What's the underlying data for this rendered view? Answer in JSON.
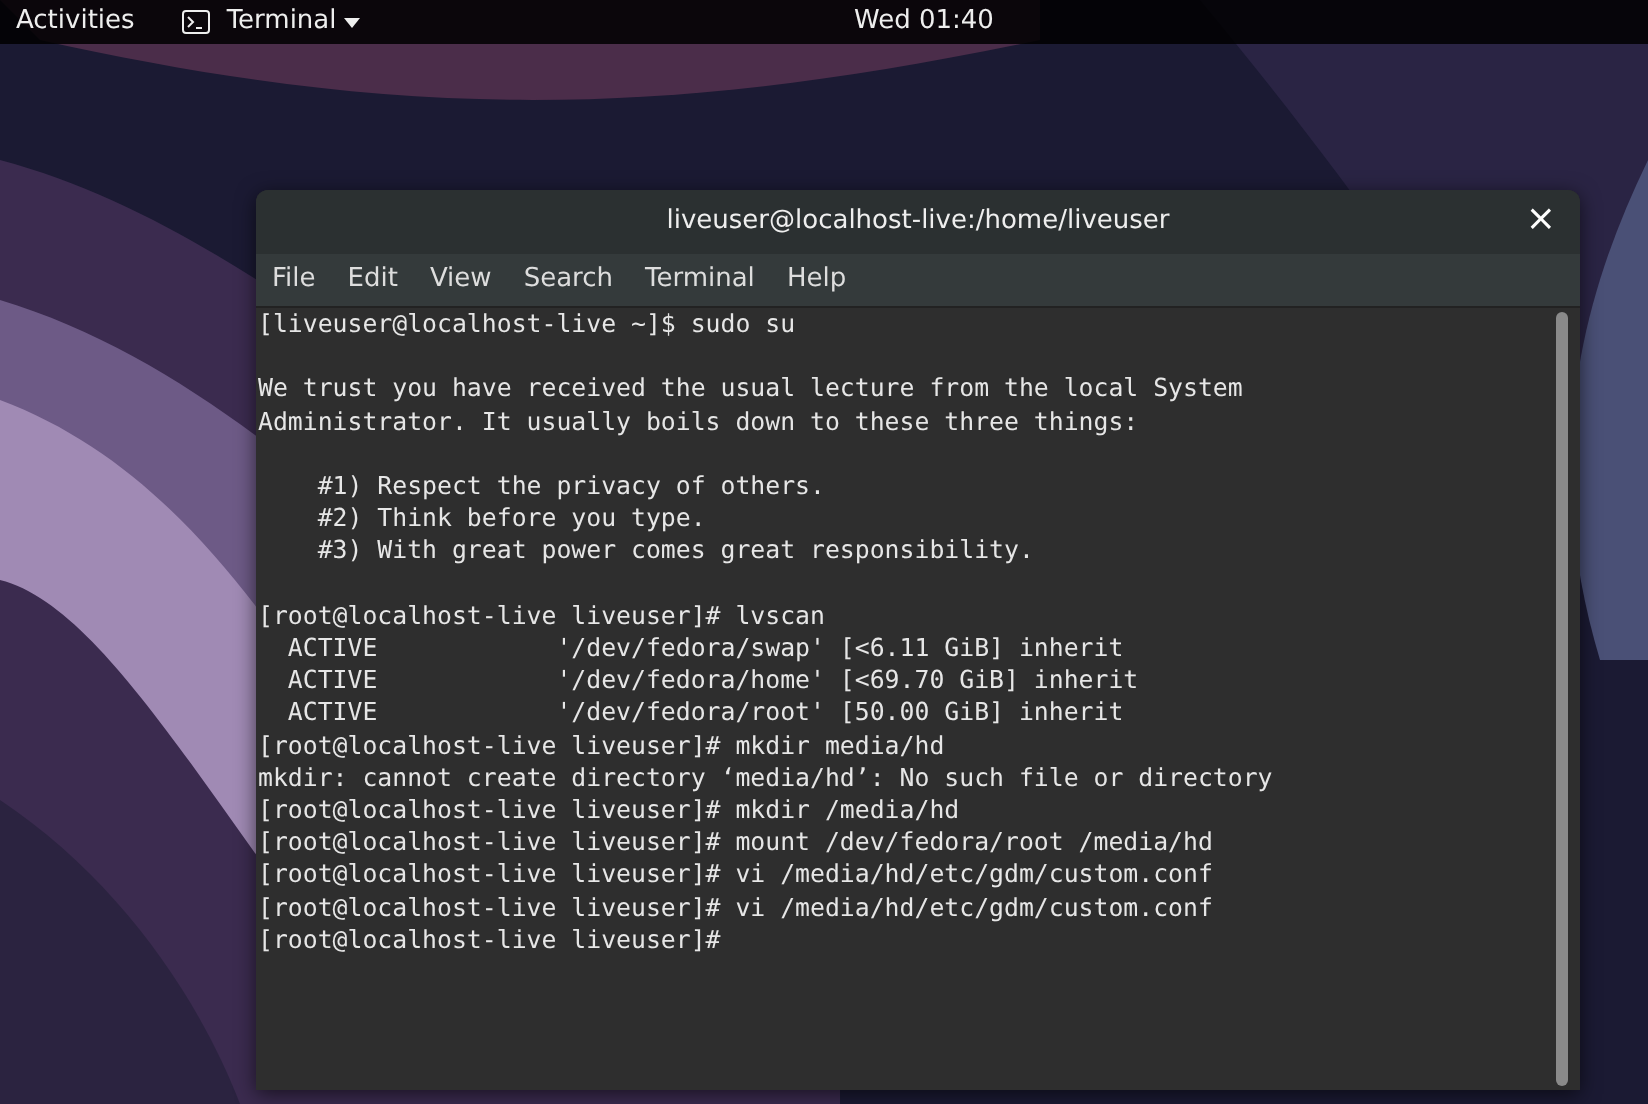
{
  "top_bar": {
    "activities": "Activities",
    "app_menu": "Terminal",
    "clock": "Wed 01:40"
  },
  "window": {
    "title": "liveuser@localhost-live:/home/liveuser",
    "close": "×"
  },
  "menu": [
    "File",
    "Edit",
    "View",
    "Search",
    "Terminal",
    "Help"
  ],
  "terminal": {
    "blocks": [
      [
        "[liveuser@localhost-live ~]$ sudo su"
      ],
      [
        "We trust you have received the usual lecture from the local System",
        "Administrator. It usually boils down to these three things:"
      ],
      [
        "    #1) Respect the privacy of others.",
        "    #2) Think before you type.",
        "    #3) With great power comes great responsibility."
      ],
      [
        "[root@localhost-live liveuser]# lvscan",
        "  ACTIVE            '/dev/fedora/swap' [<6.11 GiB] inherit",
        "  ACTIVE            '/dev/fedora/home' [<69.70 GiB] inherit",
        "  ACTIVE            '/dev/fedora/root' [50.00 GiB] inherit",
        "[root@localhost-live liveuser]# mkdir media/hd",
        "mkdir: cannot create directory ‘media/hd’: No such file or directory",
        "[root@localhost-live liveuser]# mkdir /media/hd",
        "[root@localhost-live liveuser]# mount /dev/fedora/root /media/hd",
        "[root@localhost-live liveuser]# vi /media/hd/etc/gdm/custom.conf",
        "[root@localhost-live liveuser]# vi /media/hd/etc/gdm/custom.conf",
        "[root@localhost-live liveuser]#"
      ]
    ]
  }
}
